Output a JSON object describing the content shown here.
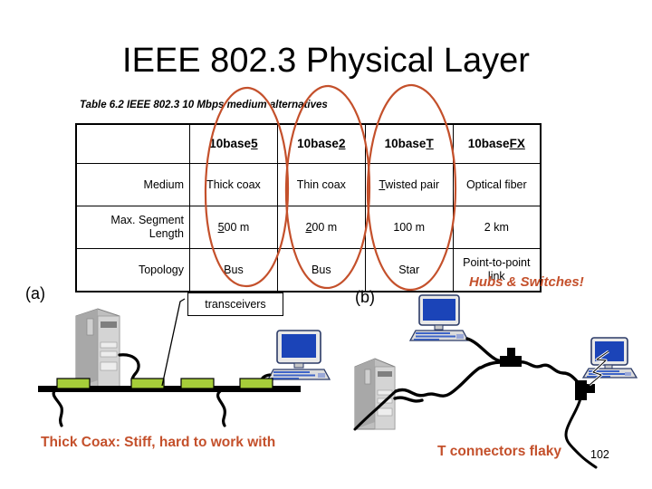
{
  "slide": {
    "title": "IEEE 802.3 Physical Layer",
    "page_number": "102"
  },
  "table": {
    "caption": "Table 6.2  IEEE 802.3 10 Mbps medium alternatives",
    "column_headers": [
      {
        "prefix": "10base",
        "suffix": "5"
      },
      {
        "prefix": "10base",
        "suffix": "2"
      },
      {
        "prefix": "10base",
        "suffix": "T"
      },
      {
        "prefix": "10base",
        "suffix": "FX"
      }
    ],
    "rows": [
      {
        "label": "Medium",
        "cells": [
          {
            "lead": "",
            "rest": "Thick coax"
          },
          {
            "lead": "",
            "rest": "Thin coax"
          },
          {
            "lead": "T",
            "rest": "wisted pair"
          },
          {
            "lead": "",
            "rest": "Optical fiber"
          }
        ]
      },
      {
        "label": "Max. Segment Length",
        "cells": [
          {
            "lead": "5",
            "rest": "00 m"
          },
          {
            "lead": "2",
            "rest": "00 m"
          },
          {
            "lead": "",
            "rest": "100 m"
          },
          {
            "lead": "",
            "rest": "2 km"
          }
        ]
      },
      {
        "label": "Topology",
        "cells": [
          {
            "lead": "",
            "rest": "Bus"
          },
          {
            "lead": "",
            "rest": "Bus"
          },
          {
            "lead": "",
            "rest": "Star"
          },
          {
            "lead": "",
            "rest": "Point-to-point link"
          }
        ]
      }
    ]
  },
  "annotations": {
    "ink_color": "#C4502B",
    "hubs_switches": "Hubs & Switches!",
    "thick_coax_note": "Thick Coax: Stiff, hard to work with",
    "t_connectors_note": "T connectors flaky",
    "circled_columns": [
      "10base5",
      "10base2",
      "10baseT"
    ]
  },
  "diagram_a": {
    "part_label": "(a)",
    "callout": "transceivers",
    "medium": "Thick Coax bus",
    "transceiver_color": "#A6CE39",
    "bus_color": "#000000",
    "devices": [
      "tower-computer",
      "desktop-computer"
    ],
    "transceiver_count": 4
  },
  "diagram_b": {
    "part_label": "(b)",
    "medium": "Thin Coax with T connectors",
    "devices": [
      "tower-computer",
      "desktop-computer",
      "desktop-computer"
    ],
    "connector_count": 2
  }
}
